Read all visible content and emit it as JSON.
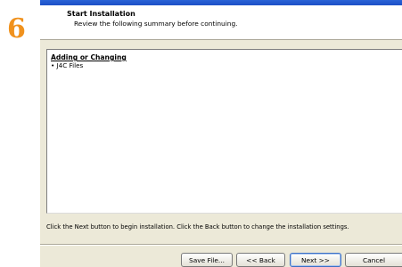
{
  "step": {
    "number": "6"
  },
  "header": {
    "title": "Start Installation",
    "subtitle": "Review the following summary before continuing."
  },
  "summary": {
    "heading": "Adding or Changing",
    "items": [
      "• J4C Files"
    ]
  },
  "instructions": "Click the Next button to begin installation.  Click the Back button to change the installation settings.",
  "buttons": {
    "save_file": "Save File...",
    "back": "<< Back",
    "next": "Next >>",
    "cancel": "Cancel"
  },
  "colors": {
    "step_number": "#f0921e",
    "dialog_background": "#ece9d8",
    "titlebar": "#2a63d6"
  }
}
